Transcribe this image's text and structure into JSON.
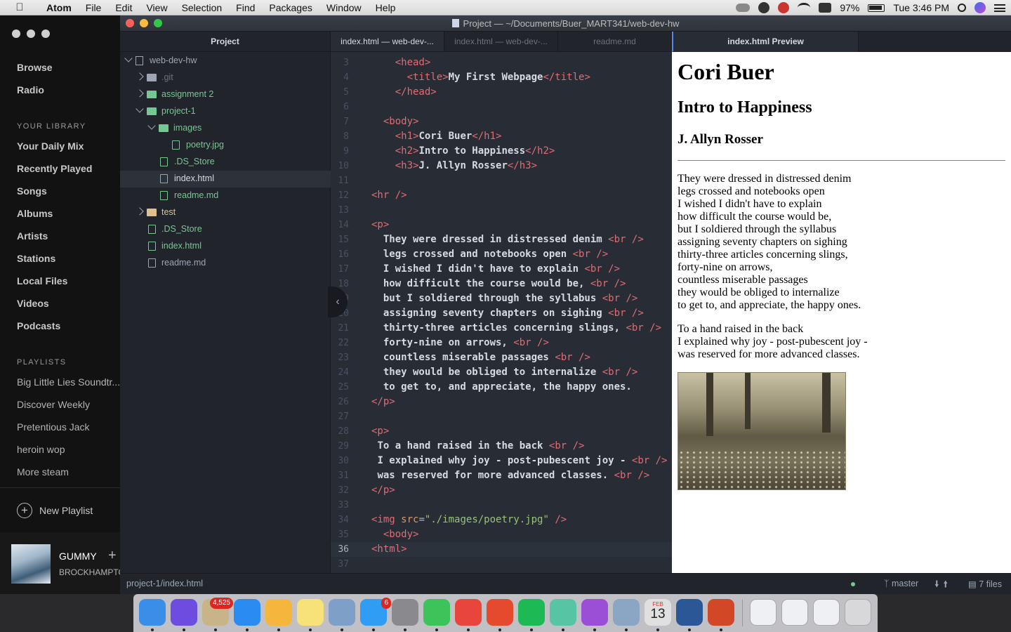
{
  "menubar": {
    "app": "Atom",
    "items": [
      "File",
      "Edit",
      "View",
      "Selection",
      "Find",
      "Packages",
      "Window",
      "Help"
    ],
    "battery": "97%",
    "clock": "Tue 3:46 PM"
  },
  "spotify": {
    "nav": [
      "Browse",
      "Radio"
    ],
    "library_heading": "YOUR LIBRARY",
    "library": [
      "Your Daily Mix",
      "Recently Played",
      "Songs",
      "Albums",
      "Artists",
      "Stations",
      "Local Files",
      "Videos",
      "Podcasts"
    ],
    "playlists_heading": "PLAYLISTS",
    "playlists": [
      "Big Little Lies Soundtr...",
      "Discover Weekly",
      "Pretentious Jack",
      "heroin wop",
      "More steam"
    ],
    "new_playlist": "New Playlist",
    "now_playing": {
      "title": "GUMMY",
      "artist": "BROCKHAMPTON"
    }
  },
  "atom": {
    "window_title": "Project — ~/Documents/Buer_MART341/web-dev-hw",
    "tree": {
      "header": "Project",
      "items": [
        {
          "name": "web-dev-hw"
        },
        {
          "name": ".git"
        },
        {
          "name": "assignment 2"
        },
        {
          "name": "project-1"
        },
        {
          "name": "images"
        },
        {
          "name": "poetry.jpg"
        },
        {
          "name": ".DS_Store"
        },
        {
          "name": "index.html"
        },
        {
          "name": "readme.md"
        },
        {
          "name": "test"
        },
        {
          "name": ".DS_Store"
        },
        {
          "name": "index.html"
        },
        {
          "name": "readme.md"
        }
      ]
    },
    "tabs": [
      "index.html — web-dev-...",
      "index.html — web-dev-...",
      "readme.md"
    ],
    "preview_tab": "index.html Preview",
    "editor": {
      "lines": [
        {
          "n": "3",
          "html": "    <span class='t'>&lt;head&gt;</span>"
        },
        {
          "n": "4",
          "html": "      <span class='t'>&lt;title&gt;</span><span class='tx'>My First Webpage</span><span class='t'>&lt;/title&gt;</span>"
        },
        {
          "n": "5",
          "html": "    <span class='t'>&lt;/head&gt;</span>"
        },
        {
          "n": "6",
          "html": ""
        },
        {
          "n": "7",
          "html": "  <span class='t'>&lt;body&gt;</span>"
        },
        {
          "n": "8",
          "html": "    <span class='t'>&lt;h1&gt;</span><span class='tx'>Cori Buer</span><span class='t'>&lt;/h1&gt;</span>"
        },
        {
          "n": "9",
          "html": "    <span class='t'>&lt;h2&gt;</span><span class='tx'>Intro to Happiness</span><span class='t'>&lt;/h2&gt;</span>"
        },
        {
          "n": "10",
          "html": "    <span class='t'>&lt;h3&gt;</span><span class='tx'>J. Allyn Rosser</span><span class='t'>&lt;/h3&gt;</span>"
        },
        {
          "n": "11",
          "html": ""
        },
        {
          "n": "12",
          "html": "<span class='t'>&lt;hr /&gt;</span>"
        },
        {
          "n": "13",
          "html": ""
        },
        {
          "n": "14",
          "html": "<span class='t'>&lt;p&gt;</span>"
        },
        {
          "n": "15",
          "html": "  <span class='tx'>They were dressed in distressed denim</span> <span class='t'>&lt;br /&gt;</span>"
        },
        {
          "n": "16",
          "html": "  <span class='tx'>legs crossed and notebooks open</span> <span class='t'>&lt;br /&gt;</span>"
        },
        {
          "n": "17",
          "html": "  <span class='tx'>I wished I didn't have to explain</span> <span class='t'>&lt;br /&gt;</span>"
        },
        {
          "n": "18",
          "html": "  <span class='tx'>how difficult the course would be,</span> <span class='t'>&lt;br /&gt;</span>"
        },
        {
          "n": "19",
          "html": "  <span class='tx'>but I soldiered through the syllabus</span> <span class='t'>&lt;br /&gt;</span>"
        },
        {
          "n": "20",
          "html": "  <span class='tx'>assigning seventy chapters on sighing</span> <span class='t'>&lt;br /&gt;</span>"
        },
        {
          "n": "21",
          "html": "  <span class='tx'>thirty-three articles concerning slings,</span> <span class='t'>&lt;br /&gt;</span>"
        },
        {
          "n": "22",
          "html": "  <span class='tx'>forty-nine on arrows,</span> <span class='t'>&lt;br /&gt;</span>"
        },
        {
          "n": "23",
          "html": "  <span class='tx'>countless miserable passages</span> <span class='t'>&lt;br /&gt;</span>"
        },
        {
          "n": "24",
          "html": "  <span class='tx'>they would be obliged to internalize</span> <span class='t'>&lt;br /&gt;</span>"
        },
        {
          "n": "25",
          "html": "  <span class='tx'>to get to, and appreciate, the happy ones.</span>"
        },
        {
          "n": "26",
          "html": "<span class='t'>&lt;/p&gt;</span>"
        },
        {
          "n": "27",
          "html": ""
        },
        {
          "n": "28",
          "html": "<span class='t'>&lt;p&gt;</span>"
        },
        {
          "n": "29",
          "html": " <span class='tx'>To a hand raised in the back</span> <span class='t'>&lt;br /&gt;</span>"
        },
        {
          "n": "30",
          "html": " <span class='tx'>I explained why joy - post-pubescent joy -</span> <span class='t'>&lt;br /&gt;</span>"
        },
        {
          "n": "31",
          "html": " <span class='tx'>was reserved for more advanced classes.</span> <span class='t'>&lt;br /&gt;</span>"
        },
        {
          "n": "32",
          "html": "<span class='t'>&lt;/p&gt;</span>"
        },
        {
          "n": "33",
          "html": ""
        },
        {
          "n": "34",
          "html": "<span class='t'>&lt;img</span> <span class='a'>src</span>=<span class='s'>\"./images/poetry.jpg\"</span> <span class='t'>/&gt;</span>"
        },
        {
          "n": "35",
          "html": "  <span class='t'>&lt;body&gt;</span>"
        },
        {
          "n": "36",
          "html": "<span class='t'>&lt;html&gt;</span>"
        },
        {
          "n": "37",
          "html": ""
        }
      ]
    },
    "preview": {
      "h1": "Cori Buer",
      "h2": "Intro to Happiness",
      "h3": "J. Allyn Rosser",
      "stanza1": [
        "They were dressed in distressed denim",
        "legs crossed and notebooks open",
        "I wished I didn't have to explain",
        "how difficult the course would be,",
        "but I soldiered through the syllabus",
        "assigning seventy chapters on sighing",
        "thirty-three articles concerning slings,",
        "forty-nine on arrows,",
        "countless miserable passages",
        "they would be obliged to internalize",
        "to get to, and appreciate, the happy ones."
      ],
      "stanza2": [
        "To a hand raised in the back",
        "I explained why joy - post-pubescent joy -",
        "was reserved for more advanced classes."
      ]
    },
    "status": {
      "path": "project-1/index.html",
      "branch": "master",
      "files": "7 files"
    }
  },
  "dock": {
    "badges": {
      "mail": "4,525",
      "appstore": "6"
    },
    "calendar_month": "FEB",
    "calendar_day": "13",
    "colors": [
      "#3b8ee8",
      "#6d4de0",
      "#c9b48a",
      "#2a8cf0",
      "#f4b63c",
      "#f7e27a",
      "#7d9fc8",
      "#2f9df4",
      "#8a8a8e",
      "#3cc35a",
      "#e8453c",
      "#e64a2e",
      "#1db954",
      "#57c4a3",
      "#9b4ed6",
      "#8aa6c4",
      "#e0e0e0",
      "#2b5797",
      "#d24726"
    ]
  }
}
